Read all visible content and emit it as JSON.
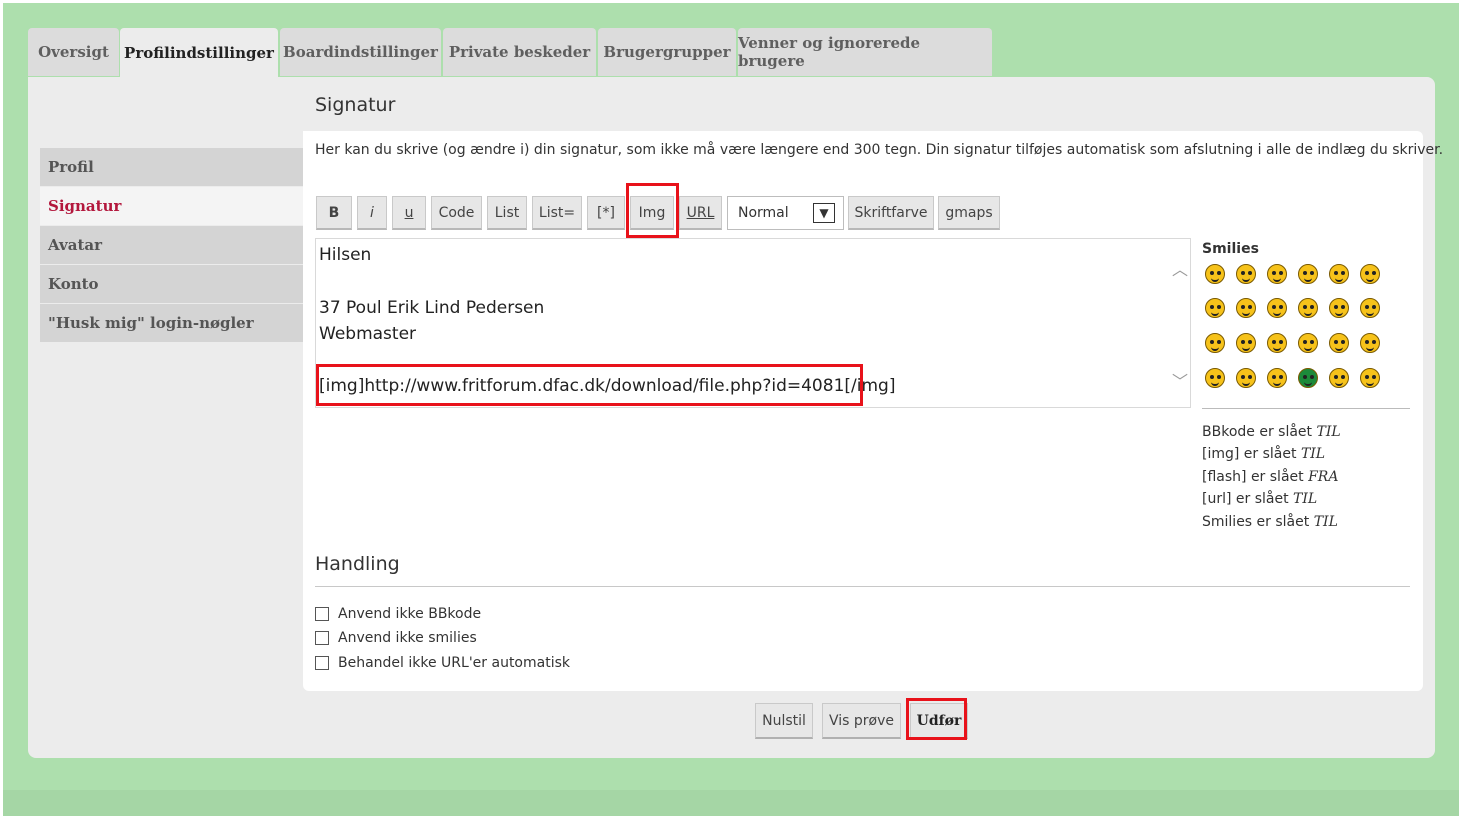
{
  "tabs": [
    {
      "label": "Oversigt"
    },
    {
      "label": "Profilindstillinger"
    },
    {
      "label": "Boardindstillinger"
    },
    {
      "label": "Private beskeder"
    },
    {
      "label": "Brugergrupper"
    },
    {
      "label": "Venner og ignorerede brugere"
    }
  ],
  "sidebar": {
    "items": [
      {
        "label": "Profil"
      },
      {
        "label": "Signatur"
      },
      {
        "label": "Avatar"
      },
      {
        "label": "Konto"
      },
      {
        "label": "\"Husk mig\" login-nøgler"
      }
    ]
  },
  "signature": {
    "title": "Signatur",
    "intro": "Her kan du skrive (og ændre i) din signatur, som ikke må være længere end 300 tegn. Din signatur tilføjes automatisk som afslutning i alle de indlæg du skriver.",
    "lines": [
      "Hilsen",
      "37 Poul Erik Lind Pedersen",
      "Webmaster",
      "[img]http://www.fritforum.dfac.dk/download/file.php?id=4081[/img]"
    ]
  },
  "toolbar": {
    "bold": "B",
    "italic": "i",
    "underline": "u",
    "code": "Code",
    "list": "List",
    "list_ordered": "List=",
    "list_item": "[*]",
    "img": "Img",
    "url": "URL",
    "font_size": "Normal",
    "font_color": "Skriftfarve",
    "gmaps": "gmaps"
  },
  "smilies": {
    "title": "Smilies"
  },
  "status": {
    "bbcode": {
      "label": "BBkode er slået",
      "value": "TIL"
    },
    "img": {
      "label": "[img] er slået",
      "value": "TIL"
    },
    "flash": {
      "label": "[flash] er slået",
      "value": "FRA"
    },
    "url": {
      "label": "[url] er slået",
      "value": "TIL"
    },
    "smilies": {
      "label": "Smilies er slået",
      "value": "TIL"
    }
  },
  "handling": {
    "title": "Handling",
    "options": [
      {
        "label": "Anvend ikke BBkode"
      },
      {
        "label": "Anvend ikke smilies"
      },
      {
        "label": "Behandel ikke URL'er automatisk"
      }
    ]
  },
  "actions": {
    "reset": "Nulstil",
    "preview": "Vis prøve",
    "submit": "Udfør"
  },
  "colors": {
    "page_background": "#addfad",
    "active_link": "#b3173c",
    "highlight_box": "#e8121a"
  }
}
